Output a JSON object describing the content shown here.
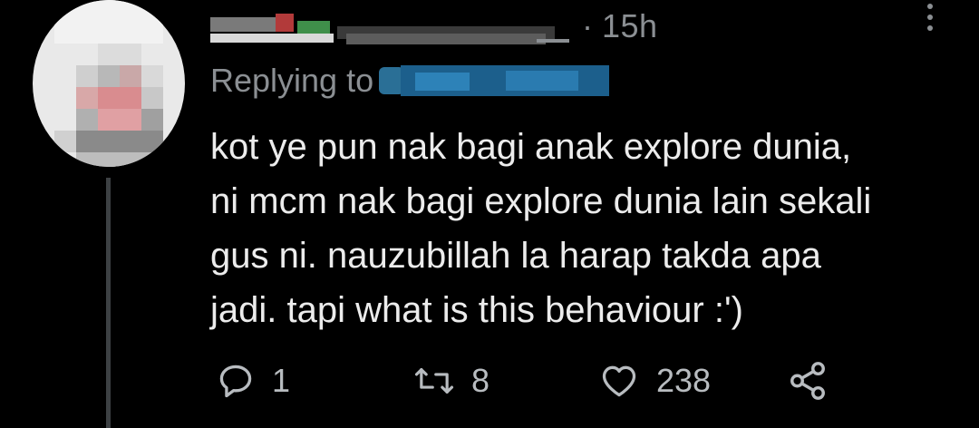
{
  "tweet": {
    "timestamp": "15h",
    "separator": "·",
    "replying_label": "Replying to",
    "body_lines": [
      "kot ye pun nak bagi anak explore dunia,",
      "ni mcm nak bagi explore dunia lain sekali",
      "gus ni. nauzubillah la harap takda apa",
      "jadi. tapi what is this behaviour :')"
    ],
    "actions": {
      "reply_count": "1",
      "retweet_count": "8",
      "like_count": "238"
    }
  },
  "icons": {
    "more": "more-vertical-icon",
    "reply": "reply-icon",
    "retweet": "retweet-icon",
    "like": "heart-icon",
    "share": "share-icon"
  },
  "colors": {
    "background": "#000000",
    "text": "#ececec",
    "muted": "#8b8f93",
    "handle_blur": "#1f6fa3"
  }
}
